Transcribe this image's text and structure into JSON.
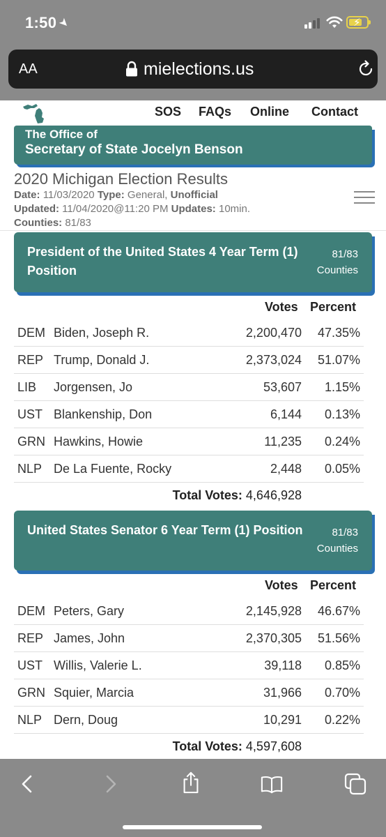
{
  "status_bar": {
    "time": "1:50"
  },
  "browser": {
    "text_size_label": "AA",
    "domain": "mielections.us"
  },
  "nav": {
    "links": [
      "SOS",
      "FAQs",
      "Online",
      "Contact"
    ]
  },
  "office": {
    "line1": "The Office of",
    "line2": "Secretary of State Jocelyn Benson"
  },
  "results": {
    "title": "2020 Michigan Election Results",
    "date_label": "Date:",
    "date": "11/03/2020",
    "type_label": "Type:",
    "type": "General,",
    "unofficial": "Unofficial",
    "updated_label": "Updated:",
    "updated": "11/04/2020@11:20 PM",
    "updates_label": "Updates:",
    "updates": "10min.",
    "counties_label": "Counties:",
    "counties": "81/83"
  },
  "races": [
    {
      "title": "President of the United States 4 Year Term (1) Position",
      "counties": "81/83",
      "counties_label": "Counties",
      "votes_header": "Votes",
      "percent_header": "Percent",
      "rows": [
        {
          "party": "DEM",
          "candidate": "Biden, Joseph R.",
          "votes": "2,200,470",
          "percent": "47.35%"
        },
        {
          "party": "REP",
          "candidate": "Trump, Donald J.",
          "votes": "2,373,024",
          "percent": "51.07%"
        },
        {
          "party": "LIB",
          "candidate": "Jorgensen, Jo",
          "votes": "53,607",
          "percent": "1.15%"
        },
        {
          "party": "UST",
          "candidate": "Blankenship, Don",
          "votes": "6,144",
          "percent": "0.13%"
        },
        {
          "party": "GRN",
          "candidate": "Hawkins, Howie",
          "votes": "11,235",
          "percent": "0.24%"
        },
        {
          "party": "NLP",
          "candidate": "De La Fuente, Rocky",
          "votes": "2,448",
          "percent": "0.05%"
        }
      ],
      "total_label": "Total Votes:",
      "total": "4,646,928"
    },
    {
      "title": "United States Senator 6 Year Term (1) Position",
      "counties": "81/83",
      "counties_label": "Counties",
      "votes_header": "Votes",
      "percent_header": "Percent",
      "rows": [
        {
          "party": "DEM",
          "candidate": "Peters, Gary",
          "votes": "2,145,928",
          "percent": "46.67%"
        },
        {
          "party": "REP",
          "candidate": "James, John",
          "votes": "2,370,305",
          "percent": "51.56%"
        },
        {
          "party": "UST",
          "candidate": "Willis, Valerie L.",
          "votes": "39,118",
          "percent": "0.85%"
        },
        {
          "party": "GRN",
          "candidate": "Squier, Marcia",
          "votes": "31,966",
          "percent": "0.70%"
        },
        {
          "party": "NLP",
          "candidate": "Dern, Doug",
          "votes": "10,291",
          "percent": "0.22%"
        }
      ],
      "total_label": "Total Votes:",
      "total": "4,597,608"
    }
  ],
  "colors": {
    "banner": "#3f7f79",
    "banner_shadow": "#2a70b5",
    "chrome": "#8a8a8a",
    "battery": "#e8d24a"
  },
  "icons": [
    "location-arrow-icon",
    "signal-icon",
    "wifi-icon",
    "battery-charging-icon",
    "lock-icon",
    "reload-icon",
    "michigan-logo-icon",
    "menu-icon",
    "back-icon",
    "forward-icon",
    "share-icon",
    "bookmarks-icon",
    "tabs-icon"
  ]
}
